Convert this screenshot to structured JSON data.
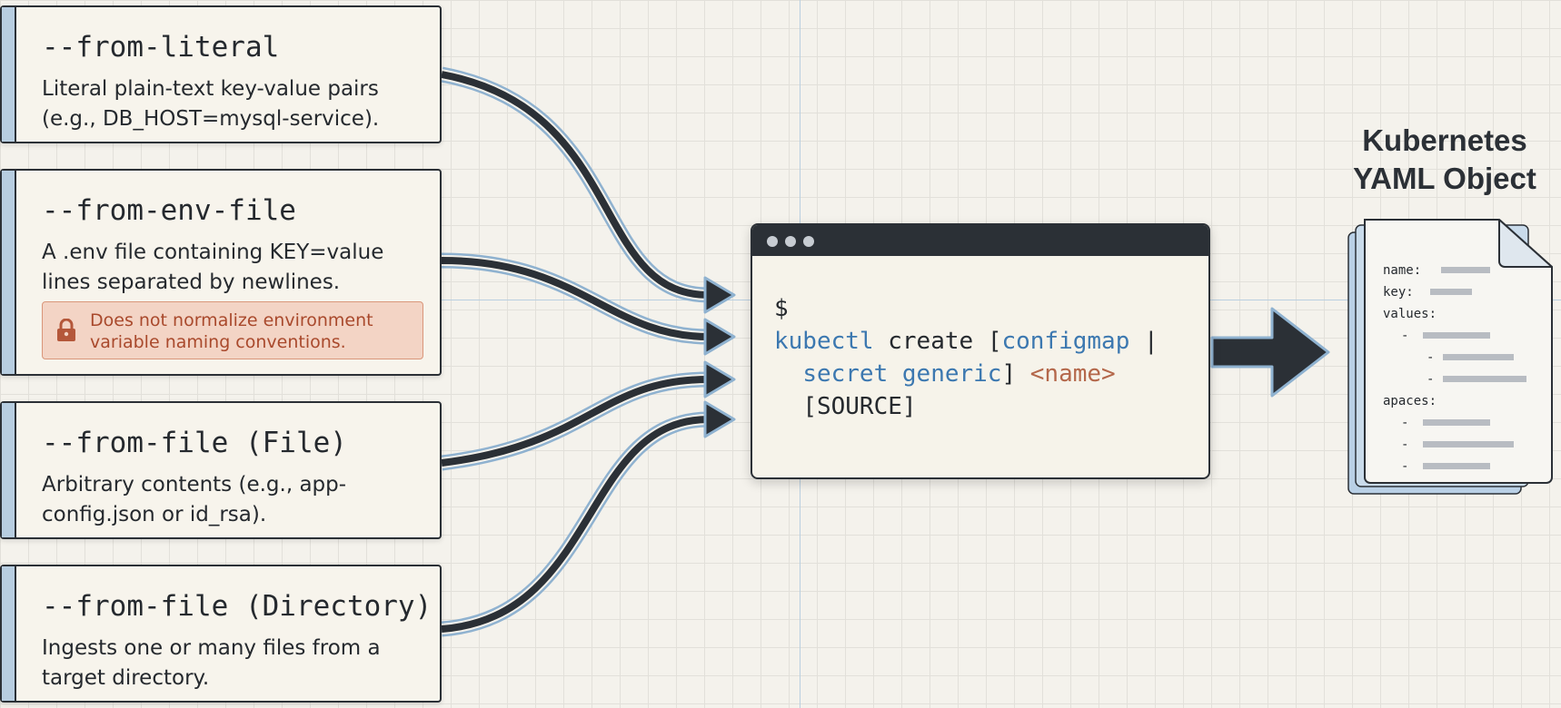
{
  "sources": [
    {
      "flag": "--from-literal",
      "description": "Literal plain-text key-value pairs (e.g., DB_HOST=mysql-service)."
    },
    {
      "flag": "--from-env-file",
      "description": "A .env file containing KEY=value lines separated by newlines.",
      "warning": {
        "icon": "lock-icon",
        "text": "Does not normalize environment variable naming conventions."
      }
    },
    {
      "flag": "--from-file (File)",
      "description": "Arbitrary contents (e.g., app-config.json or id_rsa)."
    },
    {
      "flag": "--from-file (Directory)",
      "description": "Ingests one or many files from a target directory."
    }
  ],
  "terminal": {
    "prompt": "$",
    "command": "kubectl",
    "verb": "create",
    "open_bracket": "[",
    "resource_configmap": "configmap",
    "pipe": " |",
    "resource_secret": "secret generic",
    "close_bracket": "]",
    "name_placeholder": "<name>",
    "source": "[SOURCE]"
  },
  "output": {
    "title_line1": "Kubernetes",
    "title_line2": "YAML Object",
    "yaml_keys": [
      "name:",
      "key:",
      "values:",
      "apaces:"
    ]
  },
  "colors": {
    "background": "#f4f2ec",
    "ink": "#2b3036",
    "accent_blue": "#3c78b0",
    "accent_rust": "#b4674a",
    "card_bar": "#b7cde0",
    "warning_fill": "#f3d4c5",
    "warning_text": "#a9492c"
  }
}
